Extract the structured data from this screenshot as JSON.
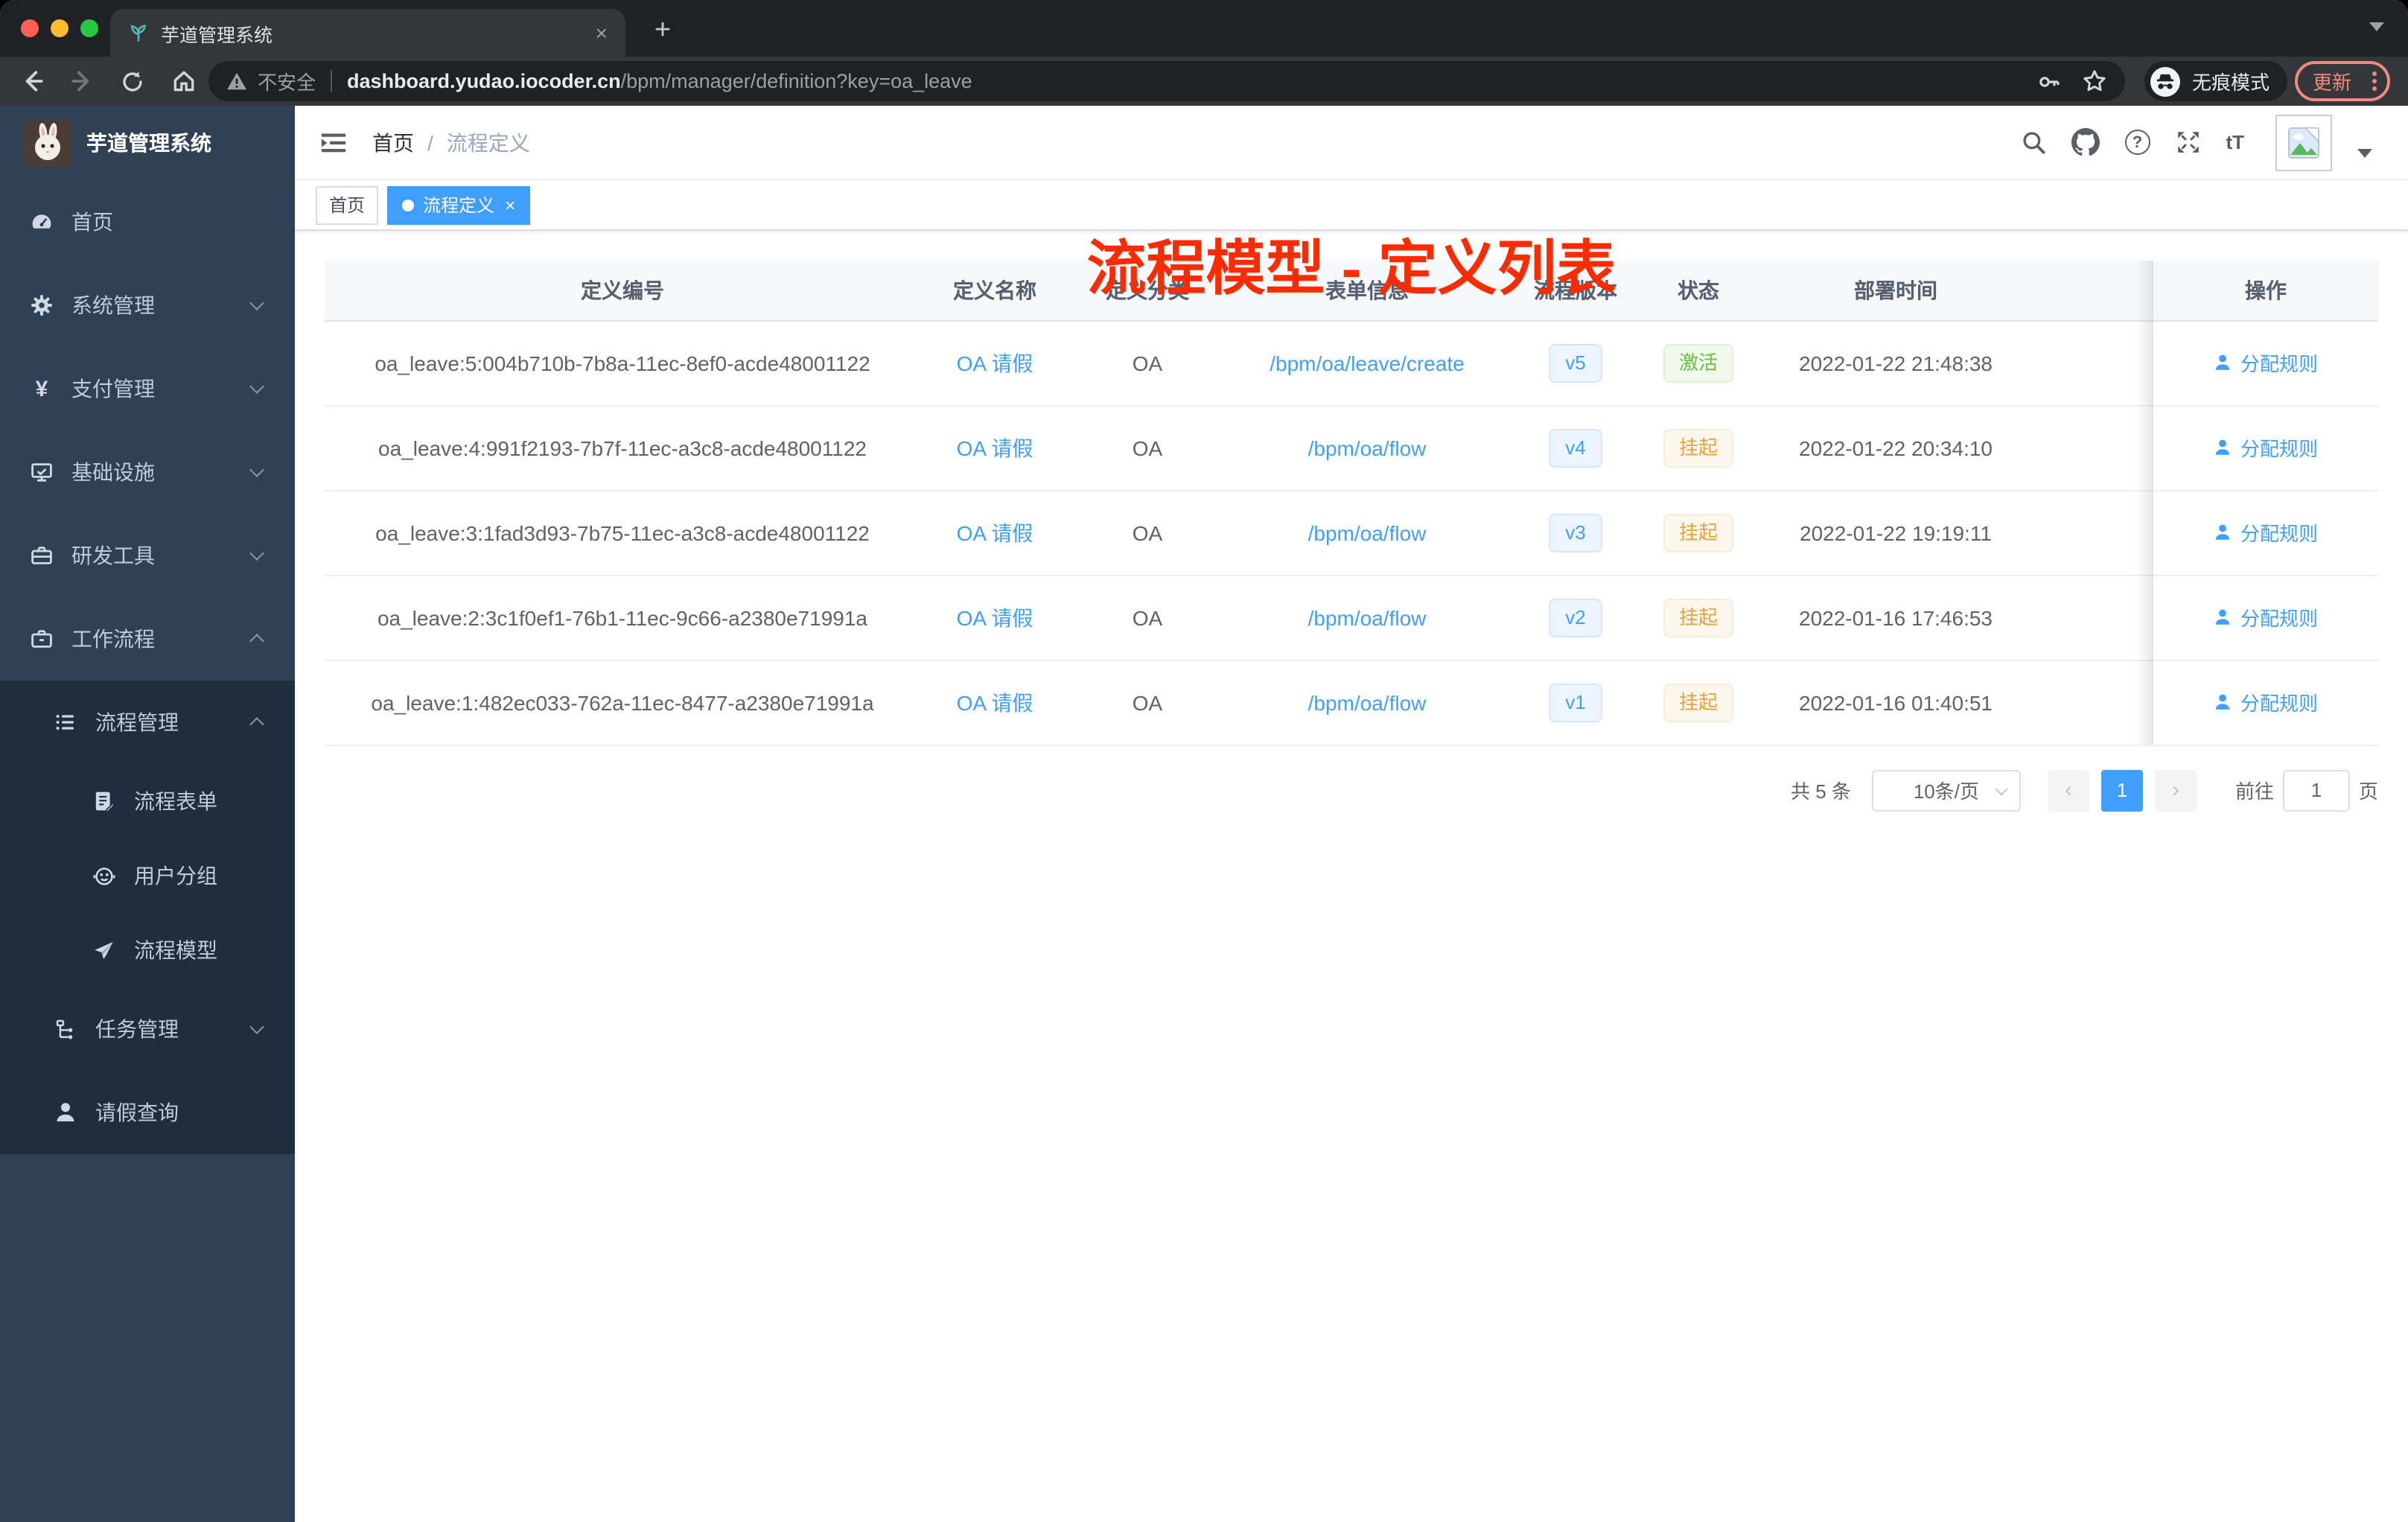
{
  "browser": {
    "tab": {
      "title": "芋道管理系统"
    },
    "address": {
      "security": "不安全",
      "domain": "dashboard.yudao.iocoder.cn",
      "path": "/bpm/manager/definition?key=oa_leave"
    },
    "incognito_label": "无痕模式",
    "update_label": "更新"
  },
  "app_header": {
    "breadcrumb": {
      "items": [
        "首页",
        "流程定义"
      ],
      "separator": "/"
    },
    "font_size_button": "tT",
    "annotation": "流程模型 - 定义列表"
  },
  "sidebar": {
    "title": "芋道管理系统",
    "items": [
      {
        "label": "首页",
        "icon": "dashboard-icon"
      },
      {
        "label": "系统管理",
        "icon": "gear-icon"
      },
      {
        "label": "支付管理",
        "icon": "yen-icon"
      },
      {
        "label": "基础设施",
        "icon": "monitor-icon"
      },
      {
        "label": "研发工具",
        "icon": "toolbox-icon"
      },
      {
        "label": "工作流程",
        "icon": "briefcase-icon"
      },
      {
        "label": "流程管理",
        "icon": "list-icon"
      },
      {
        "label": "流程表单",
        "icon": "form-icon"
      },
      {
        "label": "用户分组",
        "icon": "group-icon"
      },
      {
        "label": "流程模型",
        "icon": "paper-plane-icon"
      },
      {
        "label": "任务管理",
        "icon": "tree-icon"
      },
      {
        "label": "请假查询",
        "icon": "user-icon"
      }
    ]
  },
  "tags_view": {
    "tags": [
      {
        "label": "首页"
      },
      {
        "label": "流程定义"
      }
    ]
  },
  "table": {
    "columns": [
      "定义编号",
      "定义名称",
      "定义分类",
      "表单信息",
      "流程版本",
      "状态",
      "部署时间",
      "操作"
    ],
    "rows": [
      {
        "id": "oa_leave:5:004b710b-7b8a-11ec-8ef0-acde48001122",
        "name": "OA 请假",
        "category": "OA",
        "form": "/bpm/oa/leave/create",
        "version": "v5",
        "status": "激活",
        "deployed": "2022-01-22 21:48:38",
        "action": "分配规则"
      },
      {
        "id": "oa_leave:4:991f2193-7b7f-11ec-a3c8-acde48001122",
        "name": "OA 请假",
        "category": "OA",
        "form": "/bpm/oa/flow",
        "version": "v4",
        "status": "挂起",
        "deployed": "2022-01-22 20:34:10",
        "action": "分配规则"
      },
      {
        "id": "oa_leave:3:1fad3d93-7b75-11ec-a3c8-acde48001122",
        "name": "OA 请假",
        "category": "OA",
        "form": "/bpm/oa/flow",
        "version": "v3",
        "status": "挂起",
        "deployed": "2022-01-22 19:19:11",
        "action": "分配规则"
      },
      {
        "id": "oa_leave:2:3c1f0ef1-76b1-11ec-9c66-a2380e71991a",
        "name": "OA 请假",
        "category": "OA",
        "form": "/bpm/oa/flow",
        "version": "v2",
        "status": "挂起",
        "deployed": "2022-01-16 17:46:53",
        "action": "分配规则"
      },
      {
        "id": "oa_leave:1:482ec033-762a-11ec-8477-a2380e71991a",
        "name": "OA 请假",
        "category": "OA",
        "form": "/bpm/oa/flow",
        "version": "v1",
        "status": "挂起",
        "deployed": "2022-01-16 01:40:51",
        "action": "分配规则"
      }
    ]
  },
  "pagination": {
    "total": "共 5 条",
    "page_size": "10条/页",
    "current_page": "1",
    "goto_label": "前往",
    "goto_value": "1",
    "page_unit": "页"
  },
  "colors": {
    "accent": "#409eff",
    "annotation_red": "#ff2b00",
    "sidebar_bg": "#304156",
    "submenu_bg": "#1f2d3d",
    "tag_success": "#67c23a",
    "tag_warning": "#e6a23c",
    "update_button": "#f08a7e"
  }
}
